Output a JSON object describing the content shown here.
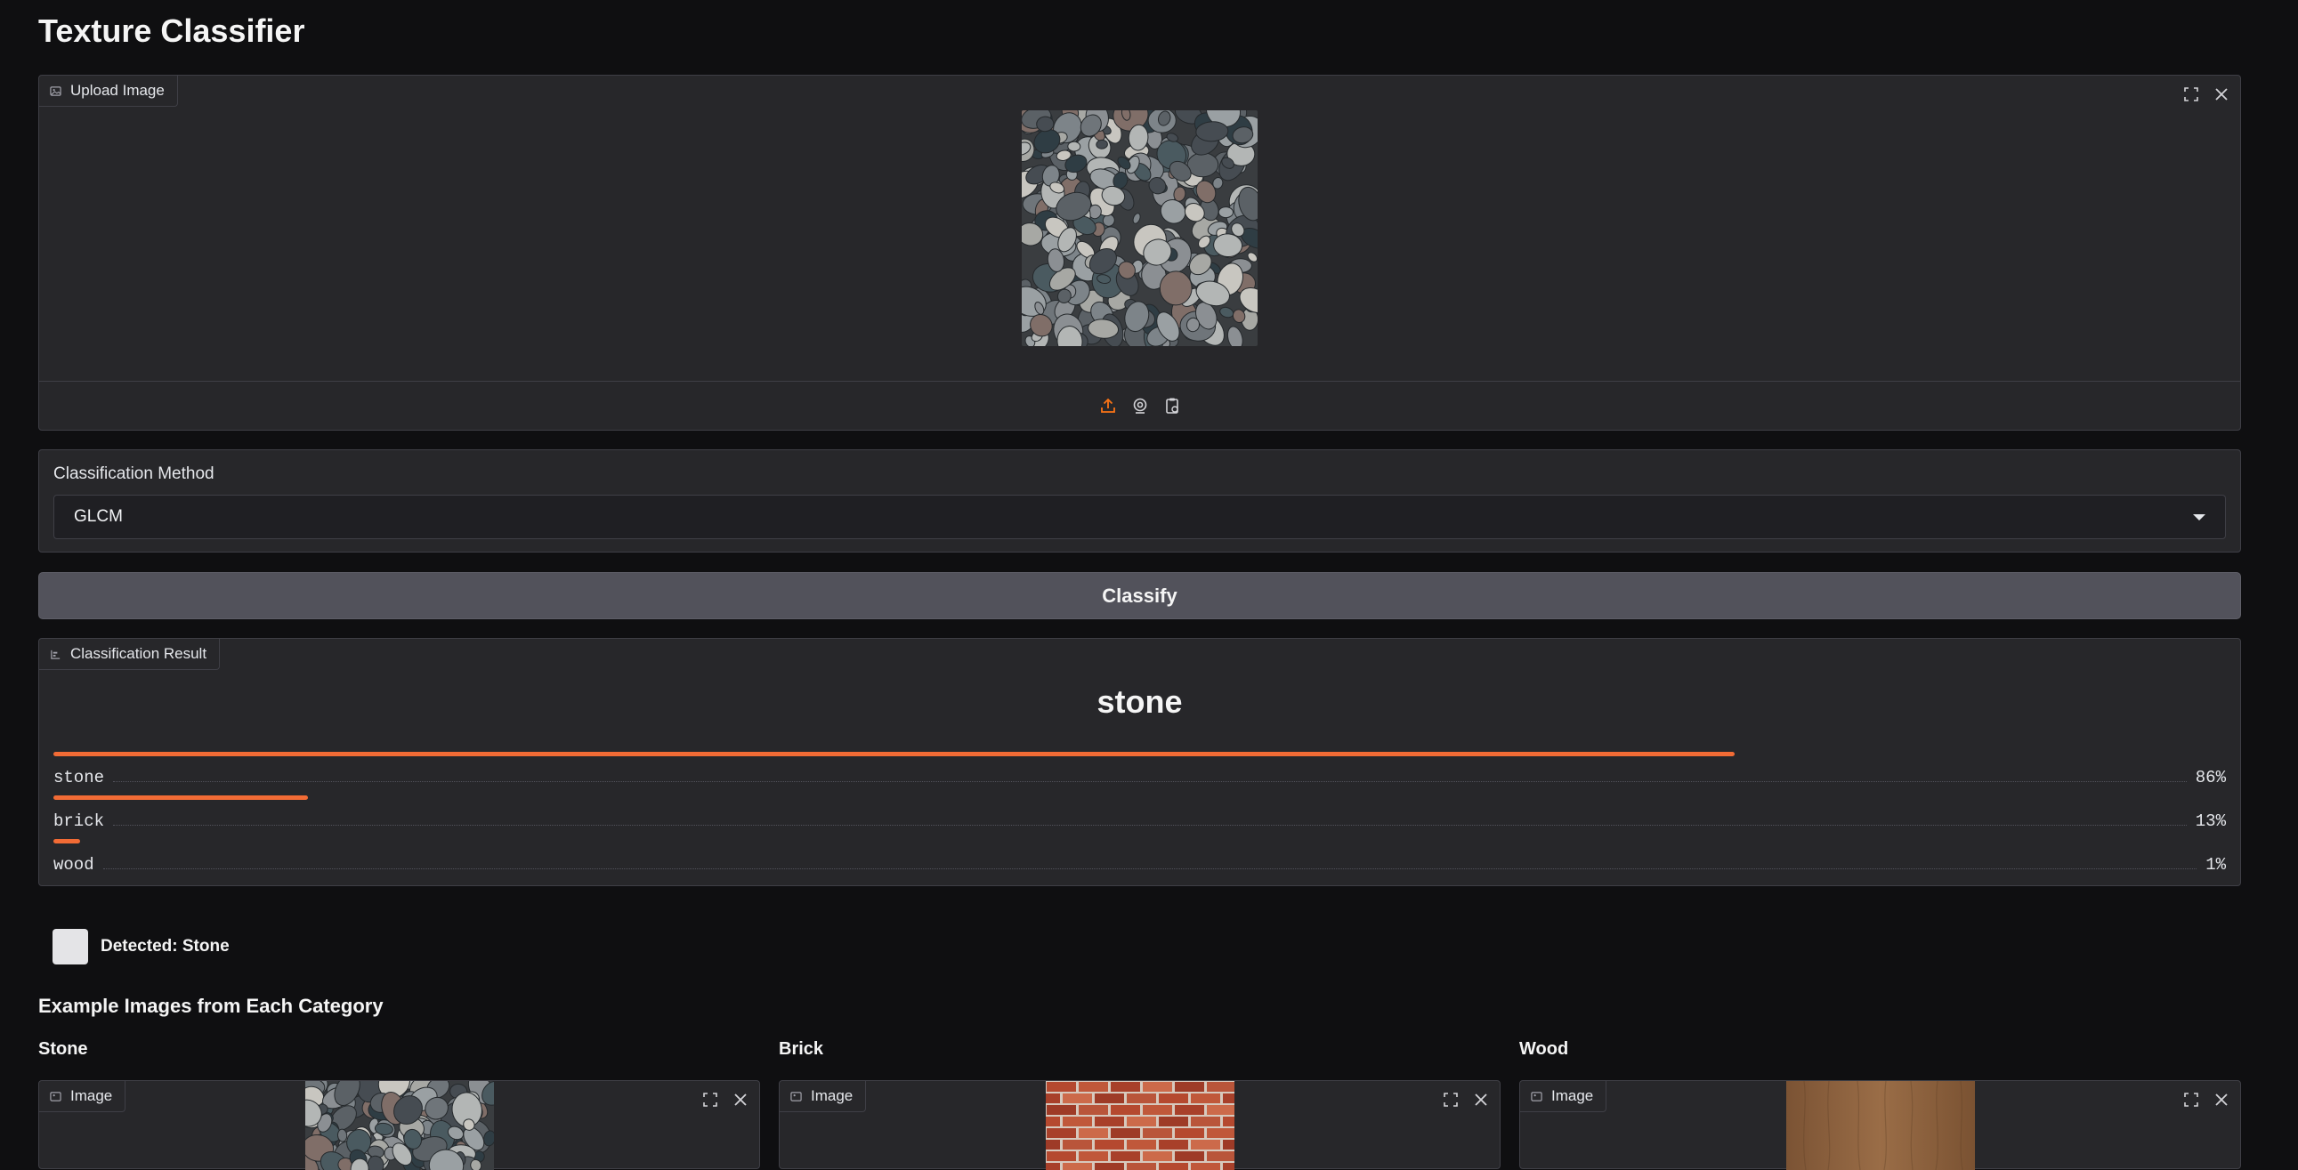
{
  "app": {
    "title": "Texture Classifier"
  },
  "upload": {
    "label": "Upload Image",
    "sources": [
      "upload-icon",
      "webcam-icon",
      "clipboard-icon"
    ],
    "accent": "#f97316"
  },
  "method": {
    "label": "Classification Method",
    "value": "GLCM"
  },
  "actions": {
    "classify_label": "Classify"
  },
  "result": {
    "label": "Classification Result",
    "top_label": "stone",
    "confidences": [
      {
        "label": "stone",
        "value": 0.86,
        "display": "86%"
      },
      {
        "label": "brick",
        "value": 0.13,
        "display": "13%"
      },
      {
        "label": "wood",
        "value": 0.01,
        "display": "1%"
      }
    ],
    "bar_color": "#f26b35"
  },
  "detected": {
    "text": "Detected: Stone",
    "swatch_color": "#e4e4e7"
  },
  "examples": {
    "heading": "Example Images from Each Category",
    "categories": [
      {
        "title": "Stone",
        "image_label": "Image"
      },
      {
        "title": "Brick",
        "image_label": "Image"
      },
      {
        "title": "Wood",
        "image_label": "Image"
      }
    ]
  }
}
